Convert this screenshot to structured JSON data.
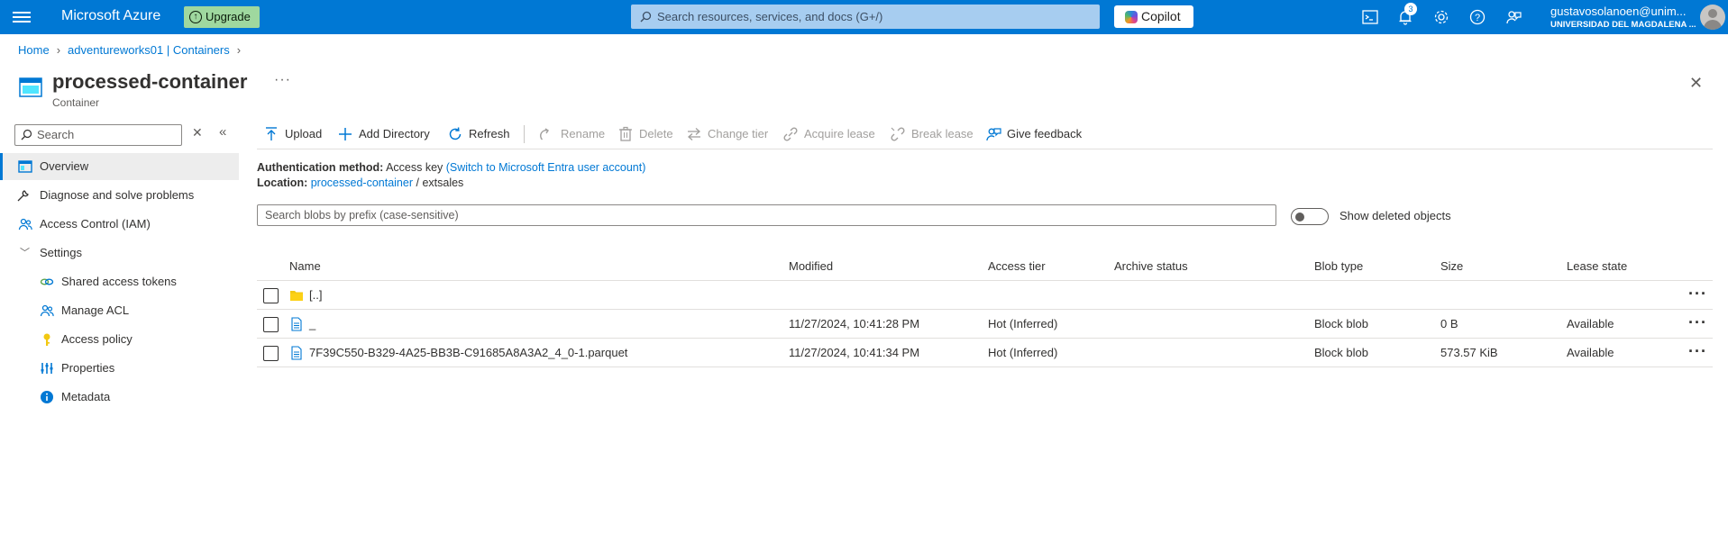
{
  "topbar": {
    "brand": "Microsoft Azure",
    "upgrade_label": "Upgrade",
    "search_placeholder": "Search resources, services, and docs (G+/)",
    "copilot_label": "Copilot",
    "notification_count": "3",
    "user_name": "gustavosolanoen@unim...",
    "user_org": "UNIVERSIDAD DEL MAGDALENA ...",
    "color": "#0078d4"
  },
  "breadcrumb": {
    "home": "Home",
    "parent": "adventureworks01 | Containers"
  },
  "header": {
    "title": "processed-container",
    "subtitle": "Container",
    "more": "···",
    "close": "✕"
  },
  "nav": {
    "search_placeholder": "Search",
    "items": [
      {
        "label": "Overview",
        "icon": "overview-icon",
        "active": true
      },
      {
        "label": "Diagnose and solve problems",
        "icon": "wrench-icon"
      },
      {
        "label": "Access Control (IAM)",
        "icon": "people-icon"
      },
      {
        "label": "Settings",
        "icon": "chevron-down-icon"
      },
      {
        "label": "Shared access tokens",
        "icon": "link-icon"
      },
      {
        "label": "Manage ACL",
        "icon": "people-icon"
      },
      {
        "label": "Access policy",
        "icon": "key-icon"
      },
      {
        "label": "Properties",
        "icon": "properties-icon"
      },
      {
        "label": "Metadata",
        "icon": "info-icon"
      }
    ]
  },
  "toolbar": {
    "upload": "Upload",
    "add_directory": "Add Directory",
    "refresh": "Refresh",
    "rename": "Rename",
    "delete": "Delete",
    "change_tier": "Change tier",
    "acquire_lease": "Acquire lease",
    "break_lease": "Break lease",
    "give_feedback": "Give feedback"
  },
  "info": {
    "auth_label": "Authentication method:",
    "auth_value": "Access key",
    "auth_link": "(Switch to Microsoft Entra user account)",
    "location_label": "Location:",
    "location_link": "processed-container",
    "location_sep": "/",
    "location_path": "extsales"
  },
  "blob_search": {
    "placeholder": "Search blobs by prefix (case-sensitive)",
    "show_deleted_label": "Show deleted objects"
  },
  "table": {
    "columns": [
      "Name",
      "Modified",
      "Access tier",
      "Archive status",
      "Blob type",
      "Size",
      "Lease state"
    ],
    "rows": [
      {
        "name": "[..]",
        "modified": "",
        "access_tier": "",
        "archive_status": "",
        "blob_type": "",
        "size": "",
        "lease_state": "",
        "icon": "folder-icon"
      },
      {
        "name": "_",
        "modified": "11/27/2024, 10:41:28 PM",
        "access_tier": "Hot (Inferred)",
        "archive_status": "",
        "blob_type": "Block blob",
        "size": "0 B",
        "lease_state": "Available",
        "icon": "file-icon"
      },
      {
        "name": "7F39C550-B329-4A25-BB3B-C91685A8A3A2_4_0-1.parquet",
        "modified": "11/27/2024, 10:41:34 PM",
        "access_tier": "Hot (Inferred)",
        "archive_status": "",
        "blob_type": "Block blob",
        "size": "573.57 KiB",
        "lease_state": "Available",
        "icon": "file-icon"
      }
    ],
    "row_more": "···"
  }
}
